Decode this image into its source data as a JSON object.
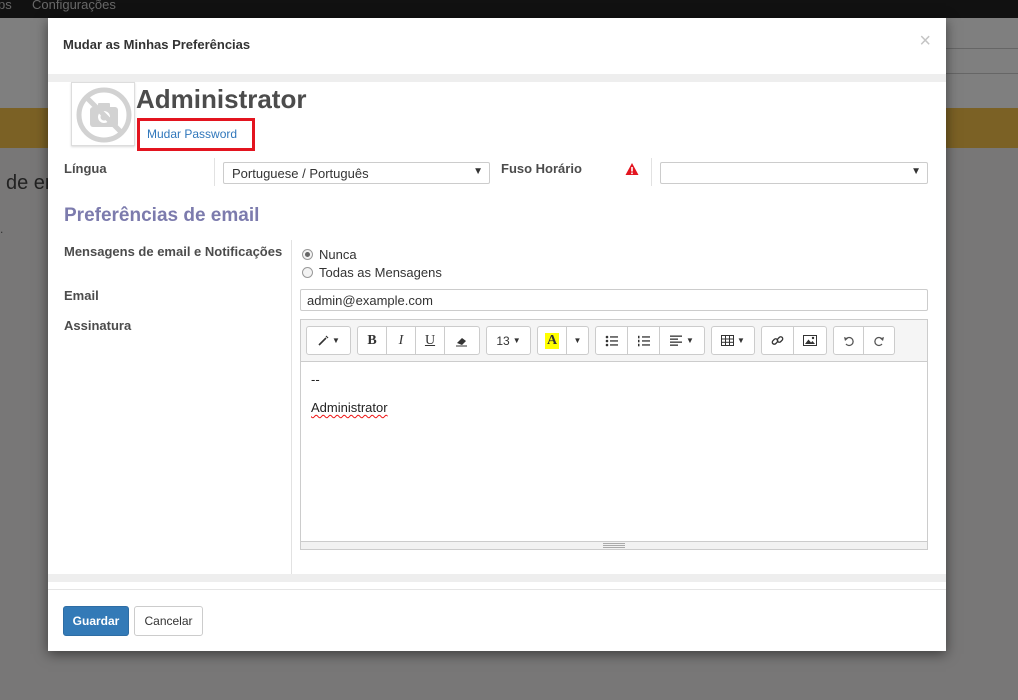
{
  "background": {
    "menu_items": [
      "ps",
      "Configurações"
    ],
    "partial_heading": "de er",
    "partial_dot": "."
  },
  "dialog": {
    "title": "Mudar as Minhas Preferências",
    "close_symbol": "×"
  },
  "user": {
    "name": "Administrator",
    "change_password_label": "Mudar Password",
    "avatar_icon": "no-photo-camera-icon"
  },
  "fields": {
    "language_label": "Língua",
    "language_value": "Portuguese / Português",
    "timezone_label": "Fuso Horário",
    "timezone_value": "",
    "timezone_warning_icon": "warning-triangle-icon",
    "timezone_warning_color": "#e3141f"
  },
  "email_preferences": {
    "section_title": "Preferências de email",
    "notifications_label": "Mensagens de email e Notificações",
    "options": [
      {
        "label": "Nunca",
        "checked": true
      },
      {
        "label": "Todas as Mensagens",
        "checked": false
      }
    ],
    "email_label": "Email",
    "email_value": "admin@example.com",
    "signature_label": "Assinatura"
  },
  "editor": {
    "font_size": "13",
    "bold": "B",
    "italic": "I",
    "underline": "U",
    "highlight": "A",
    "signature_line1": "--",
    "signature_line2": "Administrator"
  },
  "footer": {
    "save_label": "Guardar",
    "cancel_label": "Cancelar"
  },
  "colors": {
    "primary": "#337ab7",
    "section_title": "#7c7bad",
    "link": "#3077bb",
    "highlight_box": "#e3141f"
  }
}
